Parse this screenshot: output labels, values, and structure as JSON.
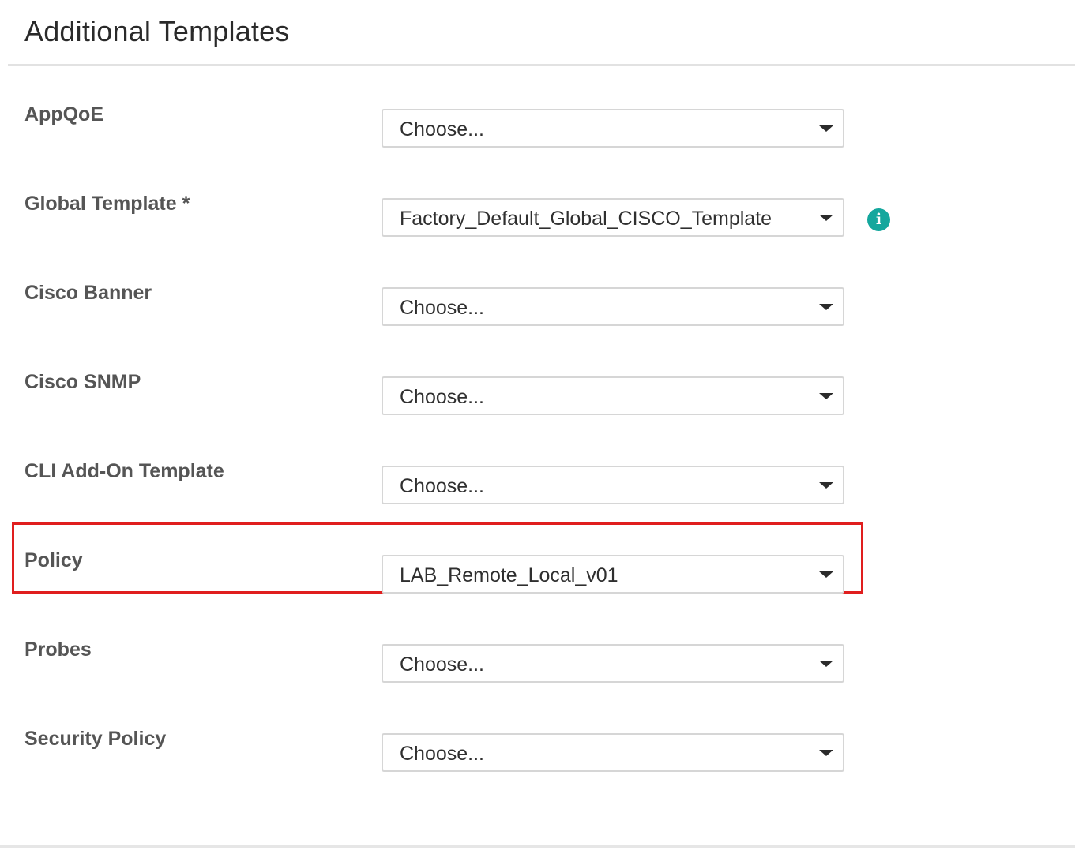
{
  "panel": {
    "title": "Additional Templates"
  },
  "fields": [
    {
      "label": "AppQoE",
      "value": "Choose..."
    },
    {
      "label": "Global Template *",
      "value": "Factory_Default_Global_CISCO_Template",
      "has_info": true
    },
    {
      "label": "Cisco Banner",
      "value": "Choose..."
    },
    {
      "label": "Cisco SNMP",
      "value": "Choose..."
    },
    {
      "label": "CLI Add-On Template",
      "value": "Choose..."
    },
    {
      "label": "Policy",
      "value": "LAB_Remote_Local_v01",
      "highlighted": true
    },
    {
      "label": "Probes",
      "value": "Choose..."
    },
    {
      "label": "Security Policy",
      "value": "Choose..."
    }
  ],
  "icons": {
    "info": "info-icon",
    "dropdown": "chevron-down-icon"
  },
  "colors": {
    "highlight": "#e01e1e",
    "info_icon": "#14a79d",
    "label_text": "#555555"
  }
}
